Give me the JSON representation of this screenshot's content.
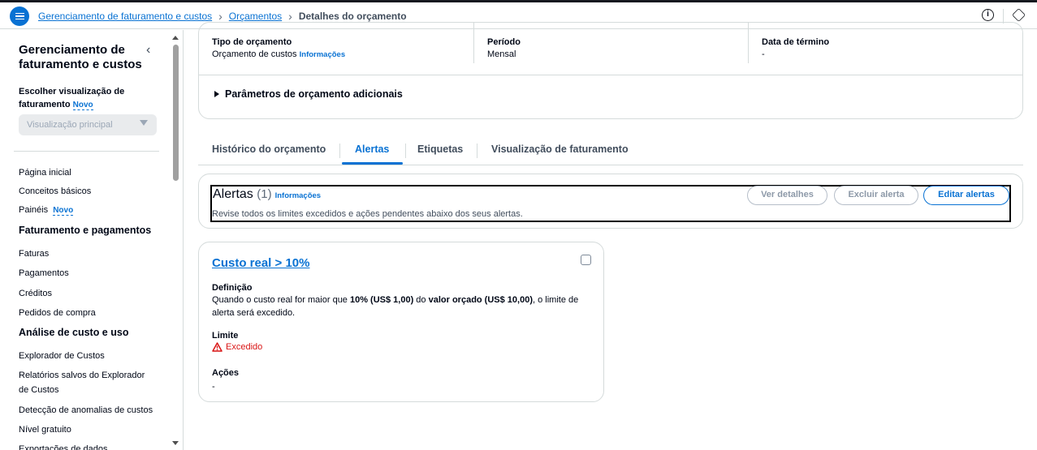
{
  "topbar": {
    "breadcrumbs": [
      "Gerenciamento de faturamento e custos",
      "Orçamentos"
    ],
    "current": "Detalhes do orçamento",
    "info_icon": "info-icon",
    "settings_icon": "settings-icon"
  },
  "sidebar": {
    "title": "Gerenciamento de faturamento e custos",
    "choose_label": "Escolher visualização de faturamento",
    "novo": "Novo",
    "select_value": "Visualização principal",
    "items_top": [
      "Página inicial",
      "Conceitos básicos",
      "Painéis"
    ],
    "section1": "Faturamento e pagamentos",
    "items_section1": [
      "Faturas",
      "Pagamentos",
      "Créditos",
      "Pedidos de compra"
    ],
    "section2": "Análise de custo e uso",
    "items_section2": [
      "Explorador de Custos",
      "Relatórios salvos do Explorador de Custos",
      "Detecção de anomalias de custos",
      "Nível gratuito",
      "Exportações de dados"
    ]
  },
  "budget": {
    "type_label": "Tipo de orçamento",
    "type_value": "Orçamento de custos",
    "type_info": "Informações",
    "period_label": "Período",
    "period_value": "Mensal",
    "end_label": "Data de término",
    "end_value": "-",
    "params": "Parâmetros de orçamento adicionais"
  },
  "tabs": [
    "Histórico do orçamento",
    "Alertas",
    "Etiquetas",
    "Visualização de faturamento"
  ],
  "alerts": {
    "title": "Alertas",
    "count": "(1)",
    "info": "Informações",
    "description": "Revise todos os limites excedidos e ações pendentes abaixo dos seus alertas.",
    "btn_details": "Ver detalhes",
    "btn_delete": "Excluir alerta",
    "btn_edit": "Editar alertas"
  },
  "alert_card": {
    "title": "Custo real > 10%",
    "definition_label": "Definição",
    "def_p1": "Quando o custo real for maior que ",
    "def_b1": "10% (US$ 1,00)",
    "def_p2": " do ",
    "def_b2": "valor orçado (US$ 10,00)",
    "def_p3": ", o limite de alerta será excedido.",
    "limit_label": "Limite",
    "limit_value": "Excedido",
    "actions_label": "Ações",
    "actions_value": "-"
  }
}
